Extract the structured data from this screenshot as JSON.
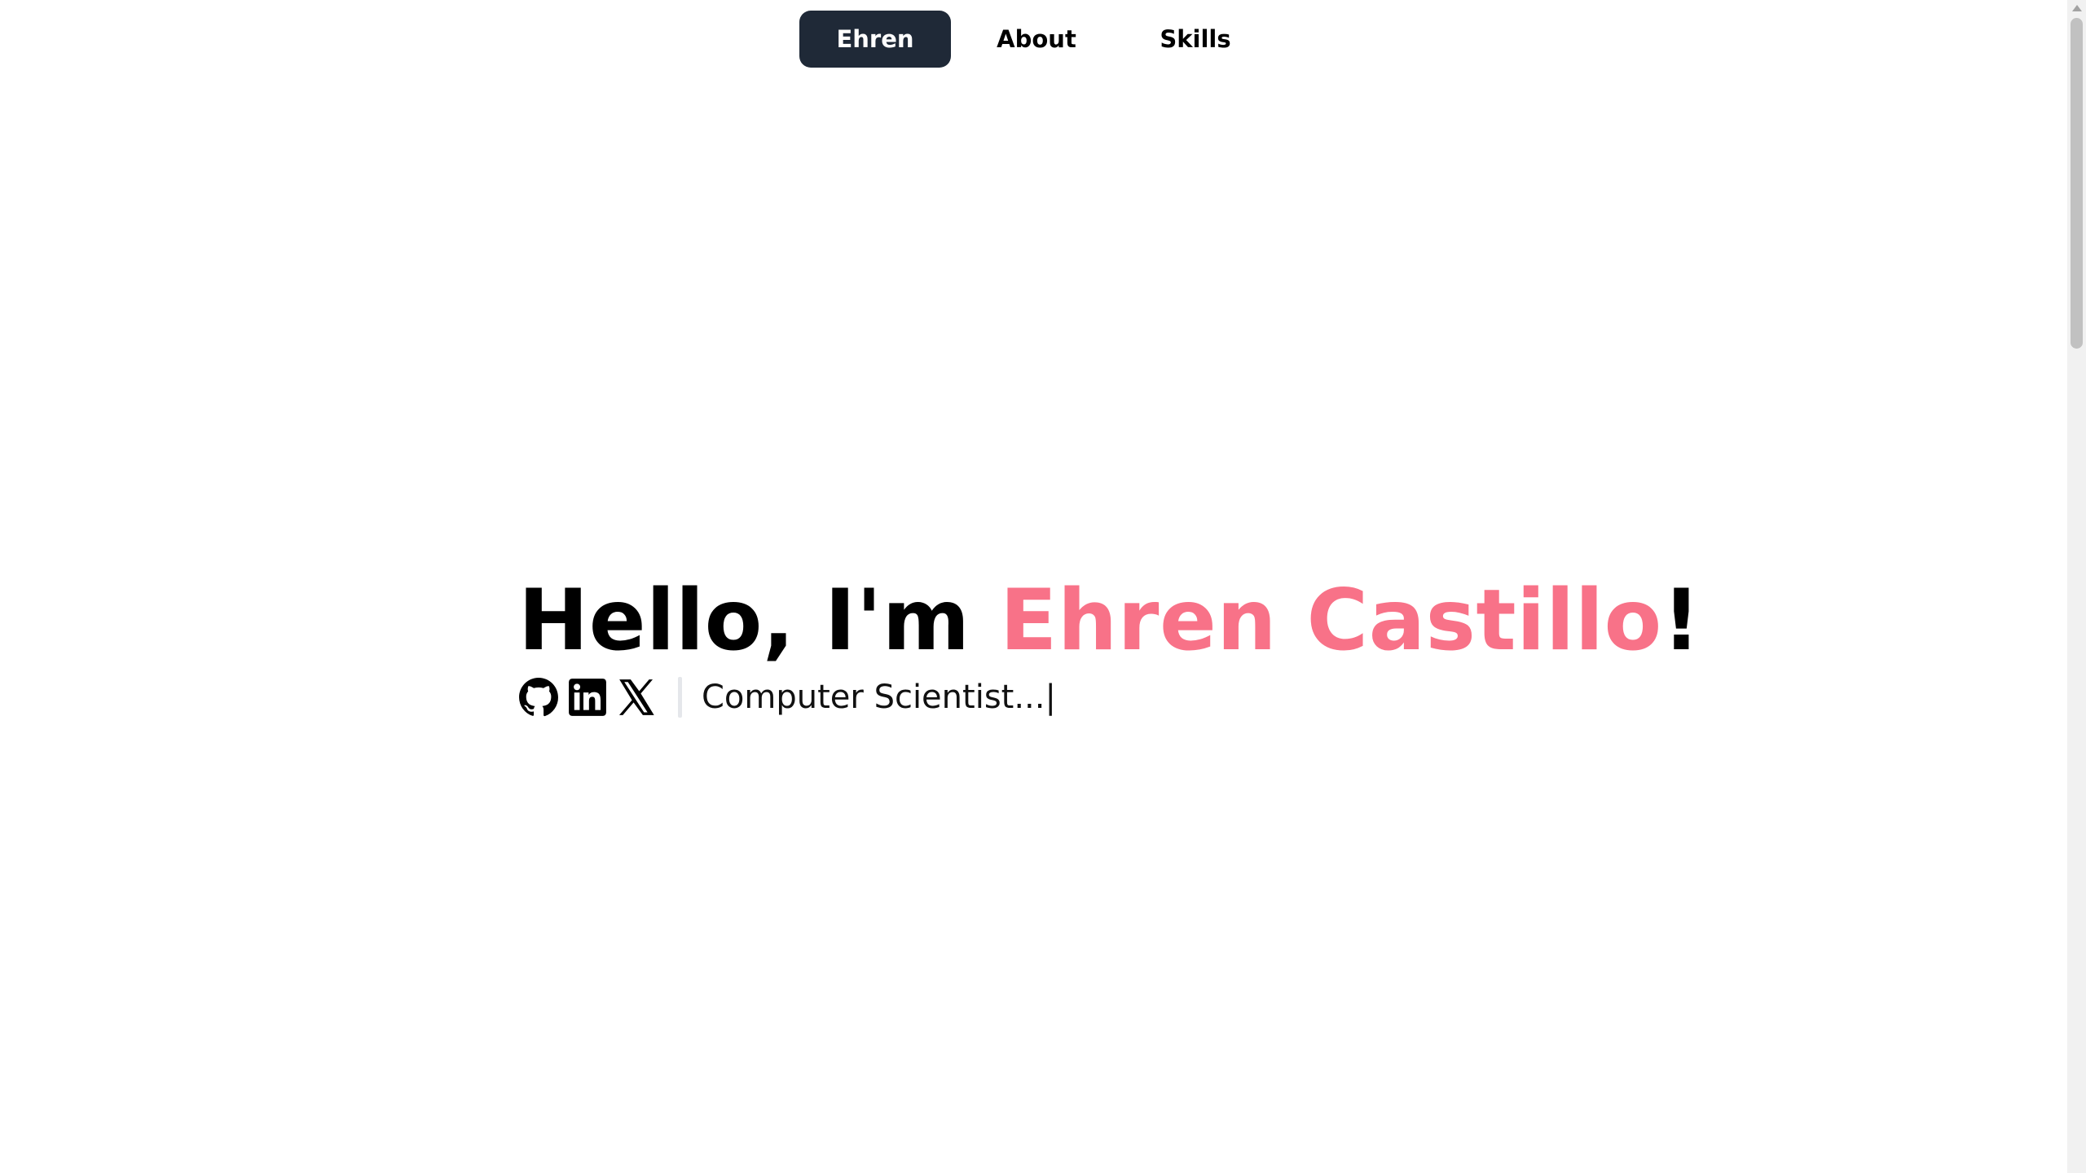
{
  "nav": {
    "items": [
      {
        "label": "Ehren",
        "active": true
      },
      {
        "label": "About",
        "active": false
      },
      {
        "label": "Skills",
        "active": false
      }
    ]
  },
  "hero": {
    "greeting": "Hello, I'm ",
    "name": "Ehren Castillo",
    "punctuation": "!",
    "tagline": "Computer Scientist...",
    "caret": "|",
    "socials": [
      {
        "icon": "github-icon"
      },
      {
        "icon": "linkedin-icon"
      },
      {
        "icon": "x-icon"
      }
    ]
  },
  "colors": {
    "accent": "#f87288",
    "nav_active_bg": "#1f2937",
    "text": "#000000",
    "background": "#ffffff"
  }
}
